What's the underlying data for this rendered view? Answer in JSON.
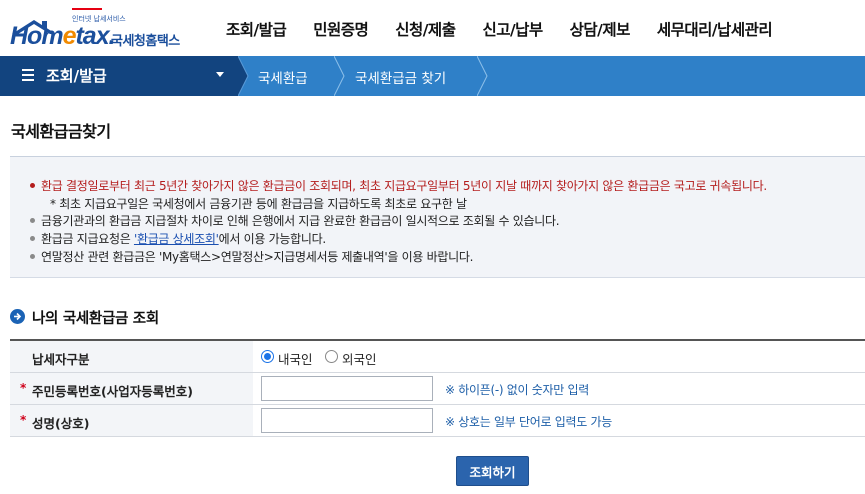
{
  "header": {
    "logo_sub": "인터넷 납세서비스",
    "logo_main_a": "Hom",
    "logo_main_e": "e",
    "logo_main_b": "tax.",
    "logo_kr": "국세청홈택스",
    "gnb": [
      "조회/발급",
      "민원증명",
      "신청/제출",
      "신고/납부",
      "상담/제보",
      "세무대리/납세관리"
    ]
  },
  "navbar": {
    "first": "조회/발급",
    "crumbs": [
      "국세환급",
      "국세환급금 찾기"
    ]
  },
  "page_title": "국세환급금찾기",
  "notice": {
    "line1": "환급 결정일로부터 최근 5년간 찾아가지 않은 환급금이 조회되며, 최초 지급요구일부터 5년이 지날 때까지 찾아가지 않은 환급금은 국고로 귀속됩니다.",
    "line1_sub": "* 최초 지급요구일은 국세청에서 금융기관 등에 환급금을 지급하도록 최초로 요구한 날",
    "line2": "금융기관과의 환급금 지급절차 차이로 인해 은행에서 지급 완료한 환급금이 일시적으로 조회될 수 있습니다.",
    "line3_pre": "환급금 지급요청은 ",
    "line3_link": "'환급금 상세조회'",
    "line3_post": "에서 이용 가능합니다.",
    "line4": "연말정산 관련 환급금은 'My홈택스>연말정산>지급명세서등 제출내역'을 이용 바랍니다."
  },
  "section_title": "나의 국세환급금 조회",
  "form": {
    "taxpayer_type_label": "납세자구분",
    "option_domestic": "내국인",
    "option_foreign": "외국인",
    "selected": "내국인",
    "rrn_label": "주민등록번호(사업자등록번호)",
    "rrn_value": "",
    "rrn_hint": "※ 하이픈(-) 없이 숫자만 입력",
    "name_label": "성명(상호)",
    "name_value": "",
    "name_hint": "※ 상호는 일부 단어로 입력도 가능",
    "required_mark": "*"
  },
  "submit_label": "조회하기",
  "colors": {
    "brand_blue": "#1b4f9c",
    "nav_dark": "#12447f",
    "nav_light": "#2f80c8",
    "notice_red": "#b41d1d",
    "hint_blue": "#1e5fa8"
  }
}
